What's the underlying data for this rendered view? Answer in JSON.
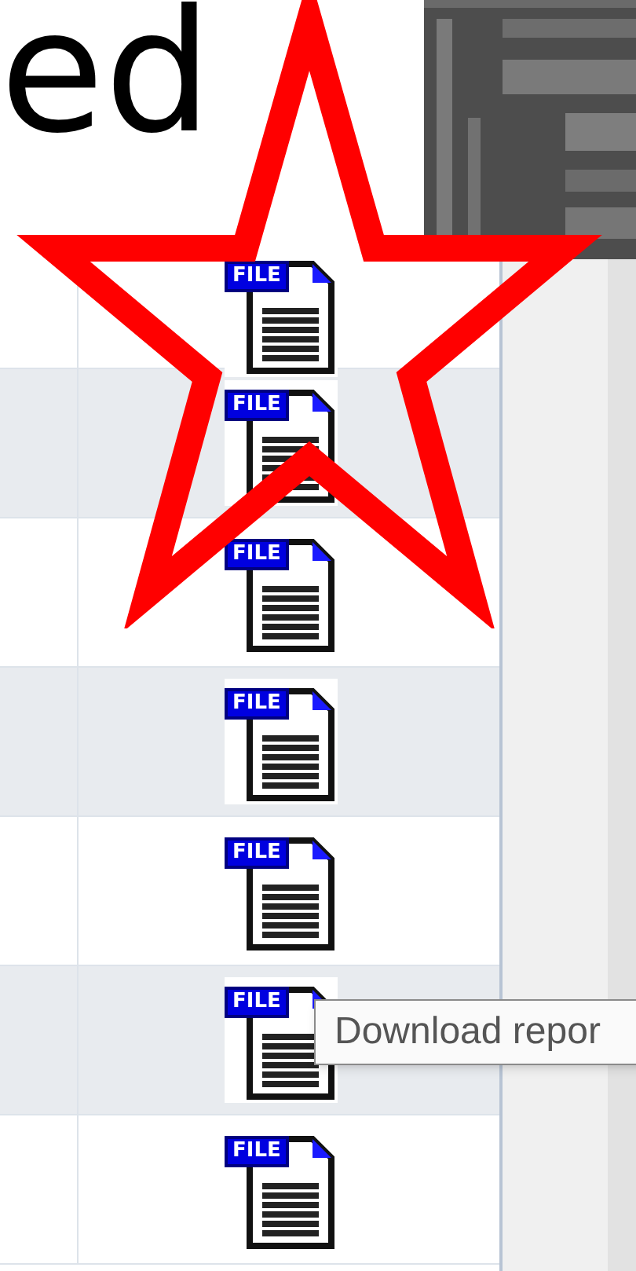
{
  "heading": {
    "text": "ed"
  },
  "table": {
    "rows": [
      {
        "icon_label": "FILE"
      },
      {
        "icon_label": "FILE"
      },
      {
        "icon_label": "FILE"
      },
      {
        "icon_label": "FILE"
      },
      {
        "icon_label": "FILE"
      },
      {
        "icon_label": "FILE"
      },
      {
        "icon_label": "FILE"
      }
    ]
  },
  "tooltip": {
    "text": "Download repor"
  },
  "annotation": {
    "kind": "star"
  }
}
